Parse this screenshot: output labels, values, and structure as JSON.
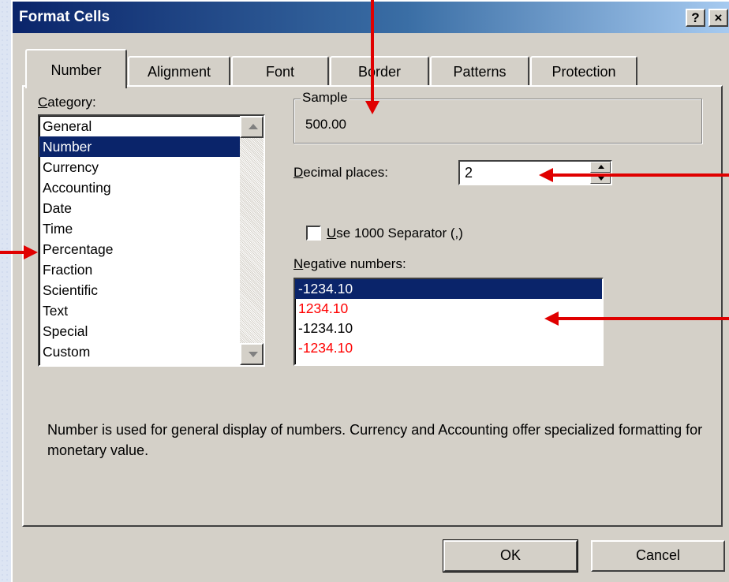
{
  "window": {
    "title": "Format Cells",
    "help_button": "?",
    "close_button": "×"
  },
  "tabs": [
    {
      "label": "Number",
      "active": true
    },
    {
      "label": "Alignment"
    },
    {
      "label": "Font"
    },
    {
      "label": "Border"
    },
    {
      "label": "Patterns"
    },
    {
      "label": "Protection"
    }
  ],
  "category": {
    "label_prefix": "C",
    "label_rest": "ategory:",
    "items": [
      "General",
      "Number",
      "Currency",
      "Accounting",
      "Date",
      "Time",
      "Percentage",
      "Fraction",
      "Scientific",
      "Text",
      "Special",
      "Custom"
    ],
    "selected": "Number"
  },
  "sample": {
    "legend": "Sample",
    "value": "500.00"
  },
  "decimal_places": {
    "label_prefix": "D",
    "label_rest": "ecimal places:",
    "value": "2"
  },
  "separator": {
    "label_prefix": "U",
    "label_rest": "se 1000 Separator (,)",
    "checked": false
  },
  "negative_numbers": {
    "label_prefix": "N",
    "label_rest": "egative numbers:",
    "items": [
      {
        "text": "-1234.10",
        "color": "#000000",
        "selected": true
      },
      {
        "text": "1234.10",
        "color": "#ff0000"
      },
      {
        "text": "-1234.10",
        "color": "#000000"
      },
      {
        "text": "-1234.10",
        "color": "#ff0000"
      }
    ]
  },
  "description": "Number is used for general display of numbers.  Currency and Accounting offer specialized formatting for monetary value.",
  "buttons": {
    "ok": "OK",
    "cancel": "Cancel"
  },
  "colors": {
    "annotation_arrow": "#e00000",
    "selection": "#0a246a",
    "dialog_face": "#d4d0c8"
  }
}
